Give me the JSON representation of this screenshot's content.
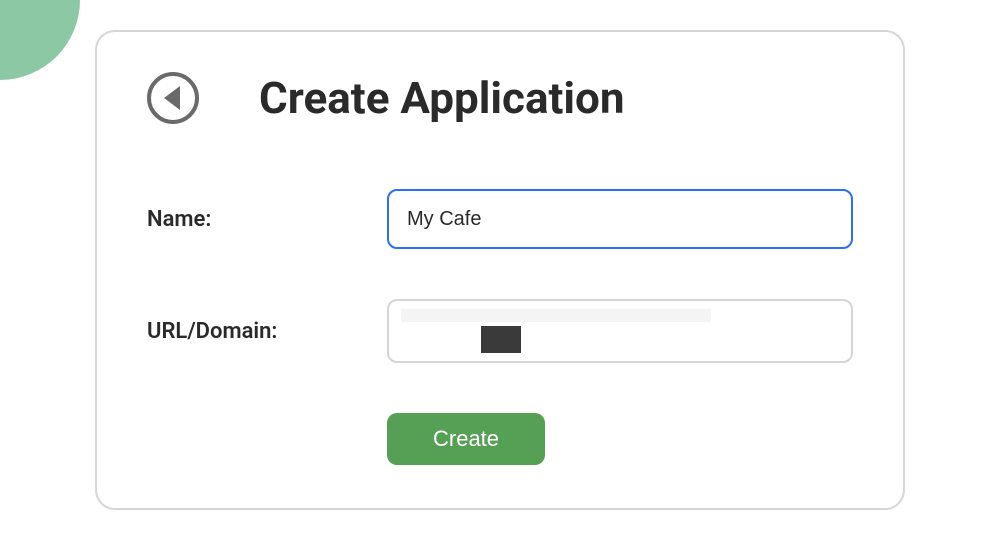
{
  "header": {
    "title": "Create Application"
  },
  "form": {
    "name": {
      "label": "Name:",
      "value": "My Cafe"
    },
    "url": {
      "label": "URL/Domain:",
      "value": ""
    }
  },
  "buttons": {
    "create": "Create"
  },
  "colors": {
    "accent_green": "#55a055",
    "blob_green": "#8cc8a4",
    "focus_blue": "#2970ff",
    "border_grey": "#d6d6d6",
    "icon_grey": "#6a6a6a"
  }
}
